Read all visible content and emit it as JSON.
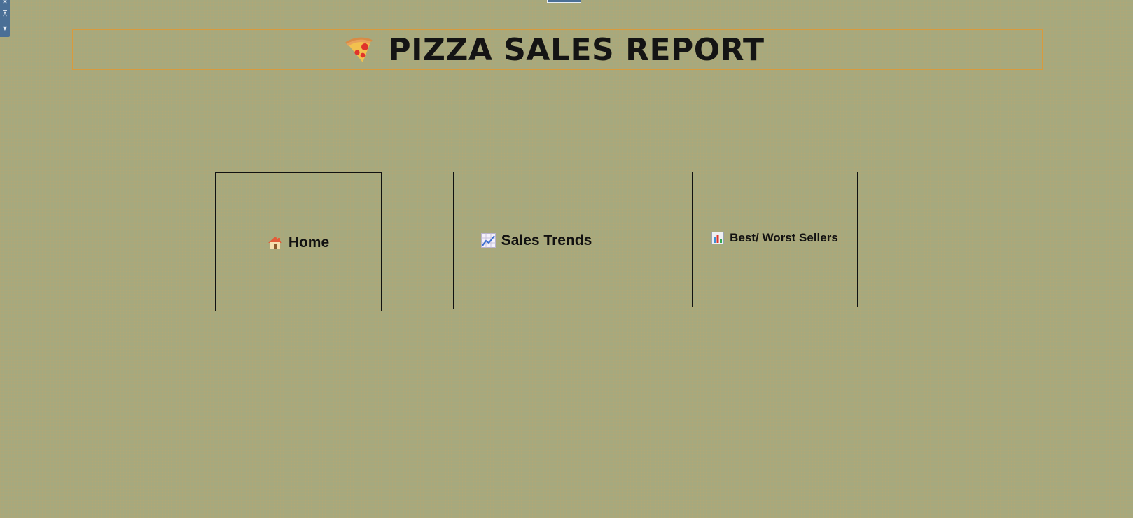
{
  "toolbar": {
    "close_glyph": "✕",
    "pin_glyph": "⊼",
    "menu_glyph": "▼",
    "icons": [
      "close-icon",
      "pin-icon",
      "dropdown-icon"
    ]
  },
  "report": {
    "title": "PIZZA SALES REPORT",
    "title_icon": "pizza-slice-icon"
  },
  "nav": {
    "items": [
      {
        "label": "Home",
        "icon": "house-icon"
      },
      {
        "label": "Sales Trends",
        "icon": "line-chart-icon"
      },
      {
        "label": "Best/ Worst Sellers",
        "icon": "bar-chart-icon"
      }
    ]
  },
  "colors": {
    "background": "#a6a97e",
    "banner_border": "#d99a3c",
    "strip": "#4a6f96",
    "text": "#111111"
  }
}
